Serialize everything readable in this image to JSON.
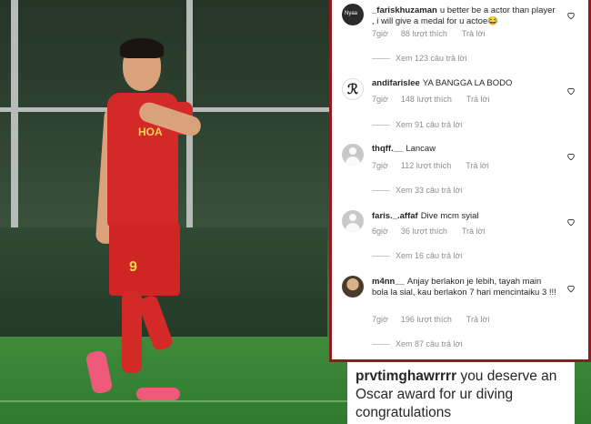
{
  "comments": [
    {
      "user": "_fariskhuzaman",
      "text": "u better be a actor than player , i will give a medal for u actoe😂",
      "time": "7giờ",
      "likes": "88 lượt thích",
      "reply": "Trả lời",
      "view_replies": "Xem 123 câu trả lời",
      "avatar": "dark-logo-avatar"
    },
    {
      "user": "andifarislee",
      "text": "YA BANGGA LA BODO",
      "time": "7giờ",
      "likes": "148 lượt thích",
      "reply": "Trả lời",
      "view_replies": "Xem 91 câu trả lời",
      "avatar": "sketch-avatar"
    },
    {
      "user": "thqff.__",
      "text": "Lancaw",
      "time": "7giờ",
      "likes": "112 lượt thích",
      "reply": "Trả lời",
      "view_replies": "Xem 33 câu trả lời",
      "avatar": "default-avatar"
    },
    {
      "user": "faris._.affaf",
      "text": "Dive mcm syial",
      "time": "6giờ",
      "likes": "36 lượt thích",
      "reply": "Trả lời",
      "view_replies": "Xem 16 câu trả lời",
      "avatar": "default-avatar"
    },
    {
      "user": "m4nn__",
      "text": "Anjay berlakon je lebih, tayah main bola la sial, kau berlakon 7 hari mencintaiku 3 !!!",
      "time": "7giờ",
      "likes": "196 lượt thích",
      "reply": "Trả lời",
      "view_replies": "Xem 87 câu trả lời",
      "avatar": "photo-avatar"
    }
  ],
  "caption": {
    "user": "prvtimghawrrrr",
    "text": "you deserve an Oscar award for ur diving congratulations"
  },
  "photo": {
    "shirt_logo": "HOA",
    "shirt_number": "9"
  },
  "colors": {
    "panel_border": "#8a1d1d",
    "meta_text": "#8e8e8e",
    "username_text": "#262626",
    "shirt_red": "#d42a27"
  }
}
